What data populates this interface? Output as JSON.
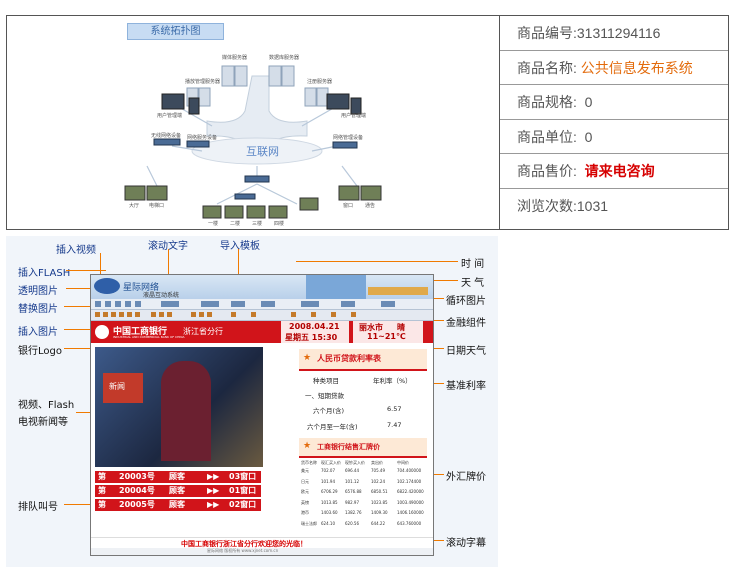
{
  "topology": {
    "title": "系统拓扑图",
    "cloud_label": "互联网",
    "node_labels": [
      "媒体服务器",
      "数据库服务器",
      "播放管理服务器",
      "注册服务器",
      "用户管理端",
      "用户管理端",
      "无线网络设备",
      "网络服务设备",
      "网络管理设备",
      "大厅",
      "电梯口",
      "一楼",
      "二楼",
      "三楼",
      "四楼",
      "窗口",
      "通告"
    ]
  },
  "product": {
    "code_label": "商品编号:",
    "code_value": "31311294116",
    "name_label": "商品名称:",
    "name_value": "公共信息发布系统",
    "spec_label": "商品规格:",
    "spec_value": "0",
    "unit_label": "商品单位:",
    "unit_value": "0",
    "price_label": "商品售价:",
    "price_value": "请来电咨询",
    "views_label": "浏览次数:",
    "views_value": "1031"
  },
  "annotations": {
    "insert_video": "插入视频",
    "scroll_text": "滚动文字",
    "import_template": "导入模板",
    "insert_flash": "插入FLASH",
    "transparent_image": "透明图片",
    "replace_image": "替换图片",
    "insert_image": "插入图片",
    "bank_logo": "银行Logo",
    "video_flash_tv": "视频、Flash\n电视新闻等",
    "queue_call": "排队叫号",
    "time": "时 间",
    "weather": "天 气",
    "loop_image": "循环图片",
    "finance_widget": "金融组件",
    "date_weather": "日期天气",
    "base_rate": "基准利率",
    "fx_price": "外汇牌价",
    "scroll_caption": "滚动字幕"
  },
  "screen": {
    "brand": "星际网络",
    "subtitle": "液晶互动系统",
    "bank_cn": "中国工商银行",
    "bank_branch": "浙江省分行",
    "bank_en": "INDUSTRIAL AND COMMERCIAL BANK OF CHINA",
    "date": "2008.04.21",
    "time": "星期五 15:30",
    "city": "丽水市",
    "weather_word": "晴",
    "temperature": "11~21℃",
    "rate_title": "人民币贷款利率表",
    "rate_head_item": "种类项目",
    "rate_head_rate": "年利率（%）",
    "rate_section": "一、短期贷款",
    "rate_rows": [
      {
        "item": "六个月(含)",
        "rate": "6.57"
      },
      {
        "item": "六个月至一年(含)",
        "rate": "7.47"
      }
    ],
    "fx_title": "工商银行结售汇牌价",
    "fx_headers": [
      "货币名称",
      "现汇买入价",
      "现钞买入价",
      "卖出价",
      "中间价"
    ],
    "fx_rows": [
      [
        "美元",
        "702.07",
        "696.44",
        "705.49",
        "704.400000"
      ],
      [
        "日元",
        "101.94",
        "101.12",
        "102.24",
        "102.174400"
      ],
      [
        "欧元",
        "6706.29",
        "6576.88",
        "6850.51",
        "6822.420000"
      ],
      [
        "英镑",
        "1013.85",
        "982.97",
        "1023.85",
        "1003.490000"
      ],
      [
        "港币",
        "1403.60",
        "1382.76",
        "1409.30",
        "1406.160000"
      ],
      [
        "瑞士法郎",
        "624.10",
        "620.56",
        "644.22",
        "643.760000"
      ]
    ],
    "news_label": "新闻",
    "queue": [
      {
        "tag": "第",
        "number": "20003号",
        "customer": "顾客",
        "window": "03窗口"
      },
      {
        "tag": "第",
        "number": "20004号",
        "customer": "顾客",
        "window": "01窗口"
      },
      {
        "tag": "第",
        "number": "20005号",
        "customer": "顾客",
        "window": "02窗口"
      }
    ],
    "ticker": "中国工商银行浙江省分行欢迎您的光临！",
    "footer": "星际网络 版权所有 www.xjnet.com.cn",
    "colors": {
      "bank_red": "#d1141a",
      "ticker_red": "#d60000",
      "accent_orange": "#f07a00"
    }
  }
}
